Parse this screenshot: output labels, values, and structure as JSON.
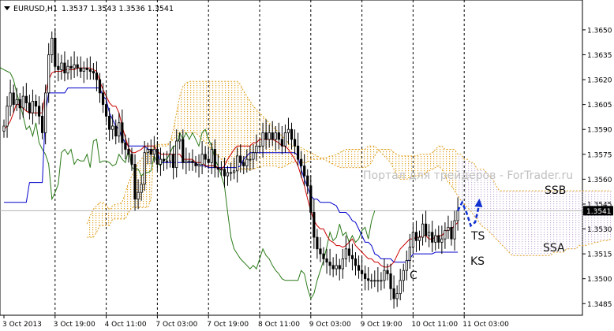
{
  "header": {
    "symbol": "EURUSD,H1",
    "ohlc": "1.3537 1.3543 1.3536 1.3541"
  },
  "watermark": "Портал для трейдеров - ForTrader.ru",
  "annotations": {
    "ssb": "SSB",
    "ssa": "SSA",
    "ts": "TS",
    "ks": "KS",
    "c": "C"
  },
  "colors": {
    "candle": "#000000",
    "tenkan": "#cc0000",
    "kijun": "#0000cc",
    "chikou": "#2a7a18",
    "kumo": "#e0a020",
    "kumo_future": "#c8b0d8",
    "forecast": "#1030d0",
    "price_box": "#000000",
    "grid": "#000000"
  },
  "chart_data": {
    "type": "candlestick",
    "title": "EURUSD,H1",
    "last_price": 1.3541,
    "ylim": [
      1.3478,
      1.3668
    ],
    "y_ticks": [
      "1.3650",
      "1.3635",
      "1.3620",
      "1.3605",
      "1.3590",
      "1.3575",
      "1.3560",
      "1.3545",
      "1.3530",
      "1.3515",
      "1.3500",
      "1.3485"
    ],
    "x_ticks": [
      "3 Oct 2013",
      "3 Oct 19:00",
      "4 Oct 11:00",
      "7 Oct 03:00",
      "7 Oct 19:00",
      "8 Oct 11:00",
      "9 Oct 03:00",
      "9 Oct 19:00",
      "10 Oct 11:00",
      "11 Oct 03:00"
    ],
    "x_tick_index": [
      0,
      16,
      32,
      48,
      64,
      80,
      96,
      112,
      128,
      144
    ],
    "grid": "vertical dotted at x ticks",
    "close": [
      1.3592,
      1.3604,
      1.3612,
      1.3605,
      1.3608,
      1.3603,
      1.361,
      1.3606,
      1.36,
      1.3607,
      1.3604,
      1.3598,
      1.3588,
      1.3612,
      1.3635,
      1.3645,
      1.3628,
      1.3626,
      1.363,
      1.3624,
      1.3628,
      1.3627,
      1.3629,
      1.3627,
      1.3625,
      1.3627,
      1.3626,
      1.3625,
      1.3624,
      1.362,
      1.3612,
      1.3605,
      1.3598,
      1.359,
      1.3592,
      1.3586,
      1.3594,
      1.3582,
      1.3578,
      1.3575,
      1.3569,
      1.3548,
      1.3552,
      1.3557,
      1.3576,
      1.3578,
      1.3575,
      1.3578,
      1.3569,
      1.3572,
      1.3571,
      1.3571,
      1.3575,
      1.3567,
      1.3583,
      1.3584,
      1.357,
      1.3571,
      1.3571,
      1.357,
      1.3568,
      1.3569,
      1.3575,
      1.3572,
      1.357,
      1.3578,
      1.3567,
      1.3566,
      1.3566,
      1.3562,
      1.3564,
      1.3564,
      1.3565,
      1.3574,
      1.357,
      1.3568,
      1.3572,
      1.3572,
      1.3576,
      1.358,
      1.358,
      1.3588,
      1.3584,
      1.3588,
      1.3584,
      1.3588,
      1.3584,
      1.358,
      1.3588,
      1.359,
      1.3584,
      1.358,
      1.3572,
      1.3568,
      1.3562,
      1.3556,
      1.354,
      1.3525,
      1.3518,
      1.3515,
      1.3512,
      1.351,
      1.3508,
      1.3506,
      1.3508,
      1.3506,
      1.3512,
      1.3518,
      1.3514,
      1.3512,
      1.3508,
      1.3505,
      1.3503,
      1.35,
      1.3499,
      1.3499,
      1.3499,
      1.3499,
      1.3499,
      1.3505,
      1.3503,
      1.3494,
      1.3488,
      1.3491,
      1.3499,
      1.3505,
      1.3511,
      1.3519,
      1.3528,
      1.3523,
      1.3525,
      1.3533,
      1.3526,
      1.3528,
      1.3522,
      1.3526,
      1.3522,
      1.3524,
      1.3529,
      1.3531,
      1.3524,
      1.3535,
      1.3541
    ],
    "chikou_offset": 26,
    "kumo_shift": 26,
    "series": [
      {
        "name": "TS",
        "values": [
          1.359,
          1.3592,
          1.3595,
          1.36,
          1.3606,
          1.3604,
          1.3603,
          1.3601,
          1.36,
          1.36,
          1.36,
          1.36,
          1.36,
          1.3612,
          1.362,
          1.3624,
          1.3625,
          1.3625,
          1.3625,
          1.3626,
          1.3626,
          1.3626,
          1.3626,
          1.3627,
          1.3627,
          1.3627,
          1.3627,
          1.3627,
          1.3626,
          1.3625,
          1.3619,
          1.3614,
          1.361,
          1.3606,
          1.3604,
          1.3604,
          1.36,
          1.3592,
          1.3585,
          1.3579,
          1.3576,
          1.3576,
          1.3577,
          1.3578,
          1.358,
          1.358,
          1.358,
          1.358,
          1.3577,
          1.3575,
          1.3575,
          1.3575,
          1.3575,
          1.3575,
          1.3575,
          1.3575,
          1.3572,
          1.3572,
          1.3572,
          1.3572,
          1.357,
          1.357,
          1.357,
          1.3568,
          1.3568,
          1.3568,
          1.3568,
          1.3567,
          1.3566,
          1.3568,
          1.3572,
          1.3575,
          1.3578,
          1.358,
          1.358,
          1.358,
          1.358,
          1.358,
          1.3582,
          1.3582,
          1.3584,
          1.3584,
          1.3584,
          1.3584,
          1.3584,
          1.3583,
          1.3582,
          1.358,
          1.358,
          1.3578,
          1.3575,
          1.3572,
          1.3568,
          1.3562,
          1.3556,
          1.3548,
          1.3541,
          1.3535,
          1.3532,
          1.353,
          1.353,
          1.3526,
          1.3523,
          1.3522,
          1.352,
          1.352,
          1.3519,
          1.352,
          1.3522,
          1.3524,
          1.352,
          1.3518,
          1.3516,
          1.3514,
          1.3512,
          1.3512,
          1.351,
          1.351,
          1.3508,
          1.3507,
          1.3507,
          1.3508,
          1.351,
          1.3514,
          1.3518,
          1.352,
          1.3522,
          1.3524,
          1.3524,
          1.3525,
          1.3525,
          1.3526,
          1.3526,
          1.3524,
          1.3524,
          1.3525,
          1.3526,
          1.3526,
          1.3528,
          1.353,
          1.353,
          1.3532,
          1.3534
        ]
      },
      {
        "name": "KS",
        "values": [
          1.3546,
          1.3546,
          1.3546,
          1.3546,
          1.3546,
          1.3546,
          1.3546,
          1.3546,
          1.3558,
          1.3558,
          1.3558,
          1.3558,
          1.3558,
          1.36,
          1.3612,
          1.3612,
          1.3612,
          1.3612,
          1.3612,
          1.3612,
          1.3615,
          1.3615,
          1.3615,
          1.3615,
          1.3615,
          1.3615,
          1.3615,
          1.3615,
          1.3615,
          1.3615,
          1.3615,
          1.361,
          1.3608,
          1.36,
          1.3596,
          1.3592,
          1.359,
          1.3585,
          1.3582,
          1.358,
          1.358,
          1.358,
          1.358,
          1.358,
          1.358,
          1.3578,
          1.3578,
          1.3577,
          1.3577,
          1.357,
          1.357,
          1.357,
          1.357,
          1.357,
          1.357,
          1.357,
          1.357,
          1.357,
          1.357,
          1.357,
          1.357,
          1.3568,
          1.3568,
          1.3568,
          1.3567,
          1.3567,
          1.3567,
          1.3567,
          1.3567,
          1.3567,
          1.3567,
          1.3567,
          1.3567,
          1.3567,
          1.3568,
          1.3572,
          1.3574,
          1.3576,
          1.3576,
          1.3576,
          1.3576,
          1.3576,
          1.3576,
          1.3576,
          1.3576,
          1.3576,
          1.3576,
          1.3576,
          1.3576,
          1.3576,
          1.3576,
          1.3576,
          1.3574,
          1.3566,
          1.356,
          1.3555,
          1.355,
          1.3548,
          1.3548,
          1.3546,
          1.3546,
          1.3546,
          1.3546,
          1.3545,
          1.3544,
          1.354,
          1.354,
          1.354,
          1.3538,
          1.3535,
          1.3534,
          1.353,
          1.3526,
          1.3522,
          1.3522,
          1.352,
          1.3515,
          1.3514,
          1.3512,
          1.3512,
          1.3512,
          1.3512,
          1.351,
          1.351,
          1.351,
          1.351,
          1.351,
          1.3512,
          1.3515,
          1.3515,
          1.3515,
          1.3515,
          1.3515,
          1.3515,
          1.3515,
          1.3516,
          1.3516,
          1.3516,
          1.3516,
          1.3516,
          1.3516,
          1.3516,
          1.3516
        ]
      },
      {
        "name": "SSA",
        "values": [
          1.3533,
          1.3538,
          1.3542,
          1.3544,
          1.3546,
          1.3546,
          1.3544,
          1.3542,
          1.3544,
          1.3545,
          1.3545,
          1.3546,
          1.3552,
          1.3558,
          1.3562,
          1.3566,
          1.357,
          1.3572,
          1.3575,
          1.3576,
          1.3578,
          1.3579,
          1.358,
          1.358,
          1.358,
          1.358,
          1.3582,
          1.3584,
          1.3586,
          1.3588,
          1.3588,
          1.3588,
          1.3588,
          1.3588,
          1.3588,
          1.3586,
          1.3584,
          1.3582,
          1.358,
          1.3578,
          1.3576,
          1.3574,
          1.3572,
          1.357,
          1.357,
          1.3568,
          1.3568,
          1.3566,
          1.3566,
          1.3566,
          1.3566,
          1.3566,
          1.3566,
          1.3567,
          1.3567,
          1.3568,
          1.3568,
          1.3568,
          1.3568,
          1.3568,
          1.3567,
          1.3567,
          1.3568,
          1.3569,
          1.357,
          1.357,
          1.357,
          1.357,
          1.357,
          1.357,
          1.3572,
          1.3572,
          1.3572,
          1.3572,
          1.3573,
          1.3573,
          1.3574,
          1.3574,
          1.3575,
          1.3576,
          1.3577,
          1.3578,
          1.3578,
          1.3578,
          1.3578,
          1.3578,
          1.3578,
          1.3578,
          1.358,
          1.358,
          1.358,
          1.3578,
          1.3576,
          1.3574,
          1.3572,
          1.357,
          1.3566,
          1.3562,
          1.356,
          1.356,
          1.356,
          1.3561,
          1.3562,
          1.3562,
          1.3562,
          1.3562,
          1.3564,
          1.3565,
          1.3566,
          1.3567,
          1.3568,
          1.3566,
          1.3562,
          1.3558,
          1.3556,
          1.3553,
          1.355,
          1.3547,
          1.3545,
          1.3543,
          1.3541,
          1.3538,
          1.3536,
          1.3533,
          1.3531,
          1.353,
          1.3528,
          1.3526,
          1.3524,
          1.3522,
          1.352,
          1.3518,
          1.3516,
          1.3514,
          1.3514,
          1.3514,
          1.3514,
          1.3514,
          1.3514,
          1.3514,
          1.3514,
          1.3514,
          1.3514,
          1.3514,
          1.3514,
          1.3514,
          1.3516,
          1.3516,
          1.3516,
          1.3516,
          1.3518,
          1.3518,
          1.3518,
          1.3518,
          1.352,
          1.352,
          1.352,
          1.3521,
          1.3521,
          1.3522,
          1.3522,
          1.3523,
          1.3523,
          1.3523,
          1.3524
        ]
      },
      {
        "name": "SSB",
        "values": [
          1.3525,
          1.3525,
          1.3525,
          1.3528,
          1.3532,
          1.3532,
          1.3532,
          1.3532,
          1.3536,
          1.3536,
          1.3536,
          1.3536,
          1.3536,
          1.354,
          1.3543,
          1.3543,
          1.3543,
          1.3543,
          1.3543,
          1.3543,
          1.3548,
          1.358,
          1.3581,
          1.3581,
          1.3581,
          1.3581,
          1.3582,
          1.359,
          1.36,
          1.361,
          1.3616,
          1.3618,
          1.3619,
          1.3619,
          1.3619,
          1.3619,
          1.3619,
          1.3619,
          1.3619,
          1.3619,
          1.3619,
          1.3619,
          1.3619,
          1.3619,
          1.3619,
          1.3619,
          1.3619,
          1.3619,
          1.3617,
          1.3613,
          1.361,
          1.3607,
          1.3604,
          1.3602,
          1.36,
          1.3598,
          1.3596,
          1.3594,
          1.3592,
          1.359,
          1.3588,
          1.3586,
          1.3584,
          1.3582,
          1.358,
          1.358,
          1.3579,
          1.3579,
          1.3578,
          1.3577,
          1.3576,
          1.3575,
          1.3574,
          1.3573,
          1.3572,
          1.3571,
          1.357,
          1.3569,
          1.3568,
          1.3567,
          1.3567,
          1.3567,
          1.3567,
          1.3567,
          1.3567,
          1.3567,
          1.3567,
          1.3567,
          1.3568,
          1.357,
          1.3574,
          1.3577,
          1.3578,
          1.3578,
          1.3578,
          1.3578,
          1.3576,
          1.3575,
          1.3574,
          1.3574,
          1.3574,
          1.3574,
          1.3574,
          1.3574,
          1.3575,
          1.3575,
          1.3575,
          1.3575,
          1.3576,
          1.3578,
          1.358,
          1.358,
          1.3578,
          1.3578,
          1.3578,
          1.3578,
          1.3575,
          1.3575,
          1.3572,
          1.3572,
          1.357,
          1.357,
          1.3566,
          1.3566,
          1.3566,
          1.3564,
          1.3562,
          1.356,
          1.3556,
          1.3553,
          1.3553,
          1.3553,
          1.3553,
          1.3553,
          1.3553,
          1.3553,
          1.3553,
          1.3553,
          1.3553,
          1.3553,
          1.3553,
          1.3553,
          1.3553,
          1.3553,
          1.3553,
          1.3553,
          1.3553,
          1.3553,
          1.3553,
          1.3553,
          1.3553,
          1.3553,
          1.3553,
          1.3553,
          1.3553,
          1.3553,
          1.3553,
          1.3553,
          1.3553,
          1.3553,
          1.3553,
          1.3553,
          1.3553,
          1.3553,
          1.3553
        ]
      },
      {
        "name": "Forecast",
        "values": [
          1.3541,
          1.3546,
          1.354,
          1.3532,
          1.3534,
          1.3545
        ]
      }
    ]
  }
}
